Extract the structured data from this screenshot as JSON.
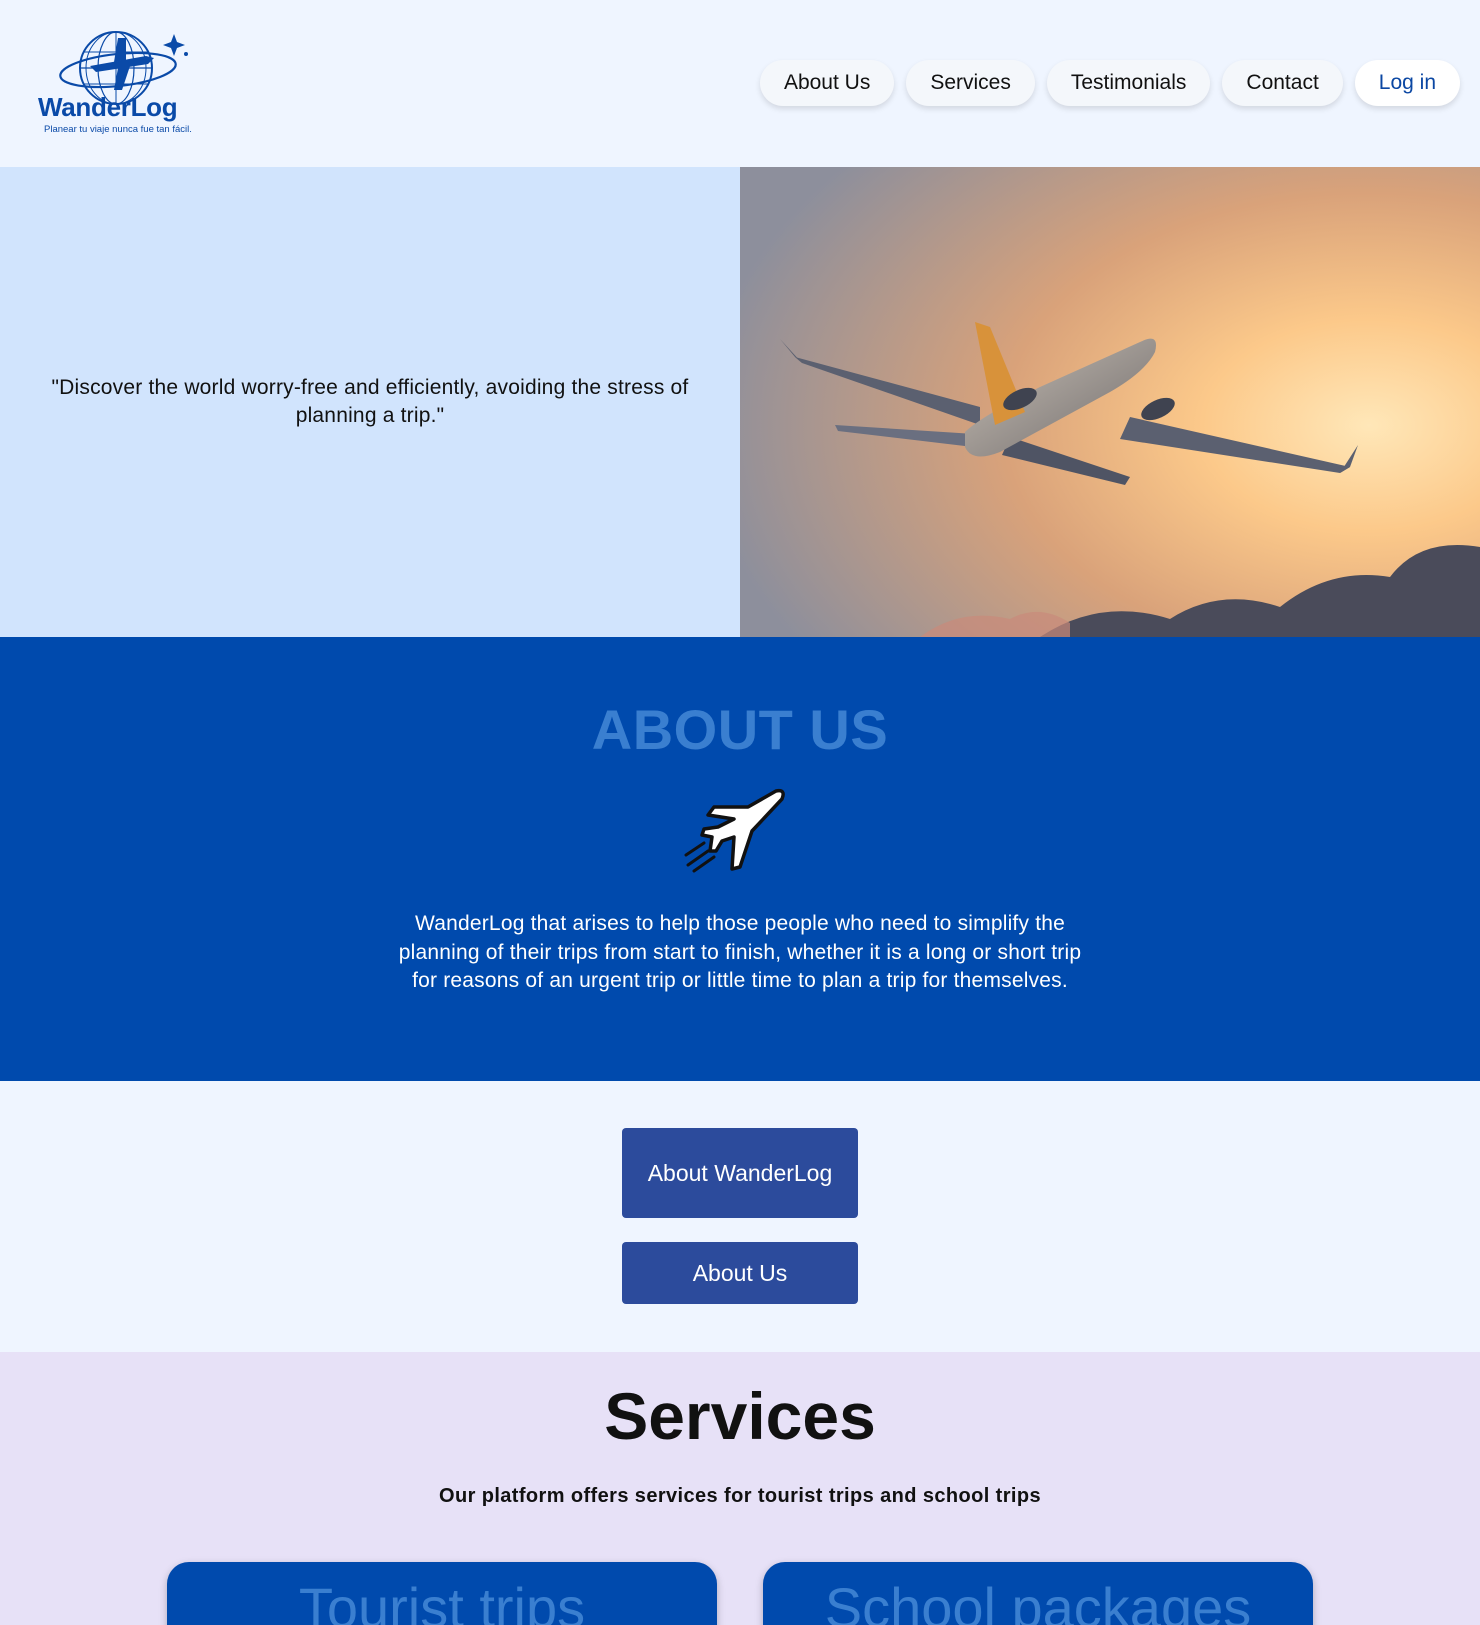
{
  "header": {
    "logo_name": "WanderLog",
    "logo_tagline": "Planear tu viaje nunca fue tan fácil.",
    "nav": [
      {
        "label": "About Us"
      },
      {
        "label": "Services"
      },
      {
        "label": "Testimonials"
      },
      {
        "label": "Contact"
      }
    ],
    "login_label": "Log in"
  },
  "hero": {
    "quote": "\"Discover the world worry-free and efficiently, avoiding the stress of planning a trip.\""
  },
  "about": {
    "title": "ABOUT US",
    "icon": "airplane-icon",
    "text": "WanderLog that arises to help those people who need to simplify the planning of their trips from start to finish, whether it is a long or short trip for reasons of an urgent trip or little time to plan a trip for themselves."
  },
  "buttons": {
    "about_wanderlog": "About WanderLog",
    "about_us": "About Us"
  },
  "services": {
    "title": "Services",
    "subtitle": "Our platform offers services for tourist trips and school trips",
    "cards": [
      {
        "title": "Tourist trips"
      },
      {
        "title": "School packages"
      }
    ]
  },
  "colors": {
    "page_bg": "#eff5ff",
    "hero_left_bg": "#d1e4fd",
    "about_bg": "#004aad",
    "about_title": "#3a7fd0",
    "button_bg": "#2c4b9c",
    "services_bg": "#e7e1f7",
    "card_bg": "#004aad"
  }
}
